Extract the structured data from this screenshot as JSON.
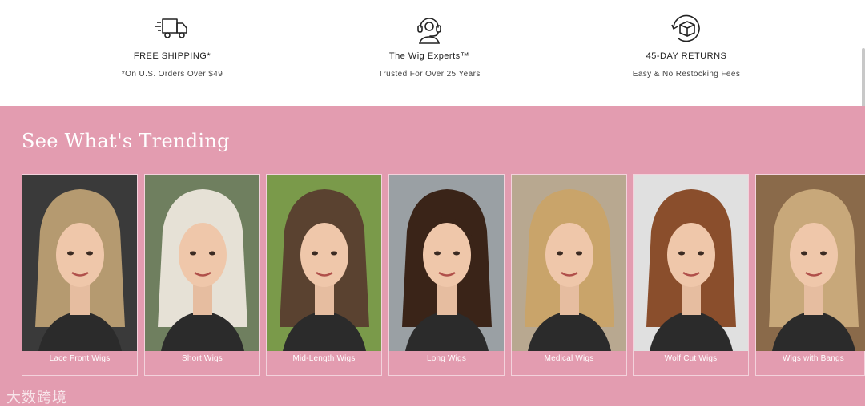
{
  "benefits": [
    {
      "icon": "truck-icon",
      "title": "FREE SHIPPING*",
      "subtitle": "*On U.S. Orders Over $49"
    },
    {
      "icon": "headset-icon",
      "title": "The Wig Experts™",
      "subtitle": "Trusted For Over 25 Years"
    },
    {
      "icon": "box-return-icon",
      "title": "45-DAY RETURNS",
      "subtitle": "Easy & No Restocking Fees"
    }
  ],
  "trending": {
    "heading": "See What's Trending",
    "background": "#e39cb0",
    "cards": [
      {
        "label": "Lace Front Wigs",
        "hair": "#b59a70",
        "bg": "#3a3a3a"
      },
      {
        "label": "Short Wigs",
        "hair": "#e6e1d6",
        "bg": "#6f7f5f"
      },
      {
        "label": "Mid-Length Wigs",
        "hair": "#5a4230",
        "bg": "#7a9a4a"
      },
      {
        "label": "Long Wigs",
        "hair": "#3a2418",
        "bg": "#9aa0a4"
      },
      {
        "label": "Medical Wigs",
        "hair": "#c9a46a",
        "bg": "#b8a890"
      },
      {
        "label": "Wolf Cut Wigs",
        "hair": "#8a4e2c",
        "bg": "#e0e0e0"
      },
      {
        "label": "Wigs with Bangs",
        "hair": "#c8a87a",
        "bg": "#8a6a4a"
      }
    ]
  },
  "watermark": "大数跨境"
}
